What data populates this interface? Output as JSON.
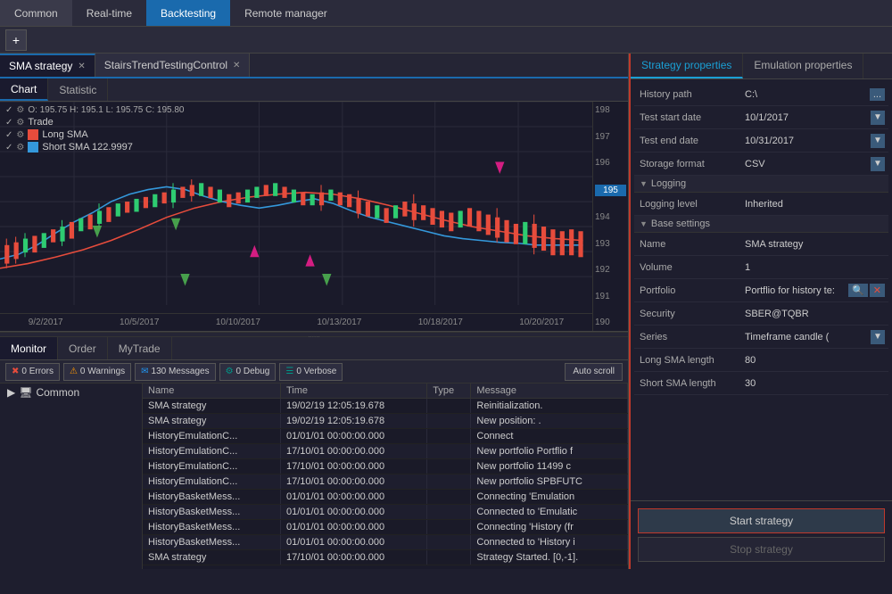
{
  "topMenu": {
    "items": [
      "Common",
      "Real-time",
      "Backtesting",
      "Remote manager"
    ],
    "activeItem": "Backtesting"
  },
  "toolbar": {
    "addLabel": "+"
  },
  "tabs": [
    {
      "label": "SMA strategy",
      "active": true,
      "closable": true
    },
    {
      "label": "StairsTrendTestingControl",
      "active": false,
      "closable": true
    }
  ],
  "chartTabs": [
    {
      "label": "Chart",
      "active": true
    },
    {
      "label": "Statistic",
      "active": false
    }
  ],
  "chartLegend": {
    "ohlc": "O: 195.75 H: 195.1 L: 195.75 C: 195.80",
    "trade": "Trade",
    "longSMA": "Long SMA",
    "shortSMA": "Short SMA 122.9997"
  },
  "chartYAxis": {
    "values": [
      "198",
      "197",
      "196",
      "195",
      "194",
      "193",
      "192",
      "191",
      "190"
    ],
    "highlighted": "195"
  },
  "chartXAxis": {
    "dates": [
      "9/2/2017",
      "10/5/2017",
      "10/10/2017",
      "10/13/2017",
      "10/18/2017",
      "10/20/2017"
    ]
  },
  "dragHandle": "......",
  "bottomTabs": [
    {
      "label": "Monitor",
      "active": true
    },
    {
      "label": "Order",
      "active": false
    },
    {
      "label": "MyTrade",
      "active": false
    }
  ],
  "statusButtons": [
    {
      "label": "0 Errors",
      "type": "red",
      "icon": "✖"
    },
    {
      "label": "0 Warnings",
      "type": "yellow",
      "icon": "⚠"
    },
    {
      "label": "130 Messages",
      "type": "blue",
      "icon": "✉"
    },
    {
      "label": "0 Debug",
      "type": "teal",
      "icon": "🐛"
    },
    {
      "label": "0 Verbose",
      "type": "teal",
      "icon": "📋"
    }
  ],
  "autoScroll": "Auto scroll",
  "monitorSidebar": {
    "items": [
      {
        "label": "Common",
        "icon": "monitor"
      }
    ]
  },
  "logTable": {
    "headers": [
      "Name",
      "Time",
      "Type",
      "Message"
    ],
    "rows": [
      {
        "name": "SMA strategy",
        "time": "19/02/19 12:05:19.678",
        "type": "",
        "message": "Reinitialization."
      },
      {
        "name": "SMA strategy",
        "time": "19/02/19 12:05:19.678",
        "type": "",
        "message": "New position: ."
      },
      {
        "name": "HistoryEmulationC...",
        "time": "01/01/01 00:00:00.000",
        "type": "",
        "message": "Connect"
      },
      {
        "name": "HistoryEmulationC...",
        "time": "17/10/01 00:00:00.000",
        "type": "",
        "message": "New portfolio Portflio f"
      },
      {
        "name": "HistoryEmulationC...",
        "time": "17/10/01 00:00:00.000",
        "type": "",
        "message": "New portfolio 11499 c"
      },
      {
        "name": "HistoryEmulationC...",
        "time": "17/10/01 00:00:00.000",
        "type": "",
        "message": "New portfolio SPBFUTC"
      },
      {
        "name": "HistoryBasketMess...",
        "time": "01/01/01 00:00:00.000",
        "type": "",
        "message": "Connecting 'Emulation"
      },
      {
        "name": "HistoryBasketMess...",
        "time": "01/01/01 00:00:00.000",
        "type": "",
        "message": "Connected to 'Emulatic"
      },
      {
        "name": "HistoryBasketMess...",
        "time": "01/01/01 00:00:00.000",
        "type": "",
        "message": "Connecting 'History (fr"
      },
      {
        "name": "HistoryBasketMess...",
        "time": "01/01/01 00:00:00.000",
        "type": "",
        "message": "Connected to 'History i"
      },
      {
        "name": "SMA strategy",
        "time": "17/10/01 00:00:00.000",
        "type": "",
        "message": "Strategy Started. [0,-1]."
      }
    ]
  },
  "strategyProperties": {
    "tabs": [
      "Strategy properties",
      "Emulation properties"
    ],
    "activeTab": "Strategy properties",
    "properties": [
      {
        "label": "History path",
        "value": "C:\\",
        "type": "path"
      },
      {
        "label": "Test start date",
        "value": "10/1/2017",
        "type": "date"
      },
      {
        "label": "Test end date",
        "value": "10/31/2017",
        "type": "date"
      },
      {
        "label": "Storage format",
        "value": "CSV",
        "type": "dropdown"
      }
    ],
    "sections": [
      {
        "name": "Logging",
        "properties": [
          {
            "label": "Logging level",
            "value": "Inherited",
            "type": "text"
          }
        ]
      },
      {
        "name": "Base settings",
        "properties": [
          {
            "label": "Name",
            "value": "SMA strategy",
            "type": "text"
          },
          {
            "label": "Volume",
            "value": "1",
            "type": "text"
          },
          {
            "label": "Portfolio",
            "value": "Portflio for history te:",
            "type": "search"
          },
          {
            "label": "Security",
            "value": "SBER@TQBR",
            "type": "text"
          },
          {
            "label": "Series",
            "value": "Timeframe candle (",
            "type": "dropdown"
          },
          {
            "label": "Long SMA length",
            "value": "80",
            "type": "text"
          },
          {
            "label": "Short SMA length",
            "value": "30",
            "type": "text"
          }
        ]
      }
    ],
    "startButton": "Start strategy",
    "stopButton": "Stop strategy"
  }
}
